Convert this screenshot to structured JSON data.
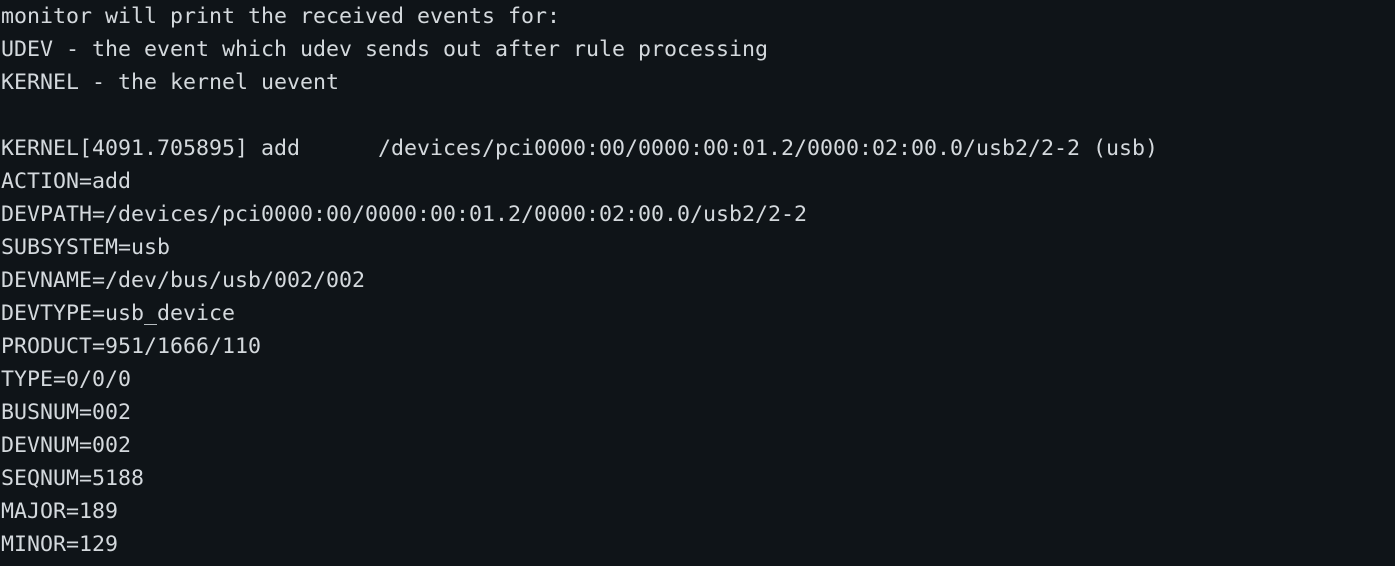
{
  "terminal": {
    "lines": [
      "monitor will print the received events for:",
      "UDEV - the event which udev sends out after rule processing",
      "KERNEL - the kernel uevent",
      "",
      "KERNEL[4091.705895] add      /devices/pci0000:00/0000:00:01.2/0000:02:00.0/usb2/2-2 (usb)",
      "ACTION=add",
      "DEVPATH=/devices/pci0000:00/0000:00:01.2/0000:02:00.0/usb2/2-2",
      "SUBSYSTEM=usb",
      "DEVNAME=/dev/bus/usb/002/002",
      "DEVTYPE=usb_device",
      "PRODUCT=951/1666/110",
      "TYPE=0/0/0",
      "BUSNUM=002",
      "DEVNUM=002",
      "SEQNUM=5188",
      "MAJOR=189",
      "MINOR=129"
    ]
  }
}
